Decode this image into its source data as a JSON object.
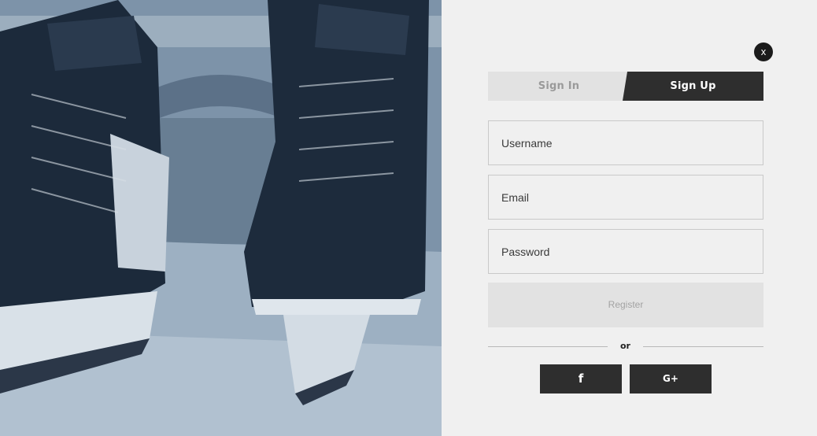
{
  "photo": {
    "alt": "hockey-skates-on-ice"
  },
  "close": {
    "label": "x"
  },
  "tabs": {
    "sign_in": "Sign In",
    "sign_up": "Sign Up",
    "active": "sign_up"
  },
  "form": {
    "username": {
      "placeholder": "Username",
      "value": ""
    },
    "email": {
      "placeholder": "Email",
      "value": ""
    },
    "password": {
      "placeholder": "Password",
      "value": ""
    },
    "register_label": "Register"
  },
  "divider": {
    "text": "or"
  },
  "social": {
    "facebook": {
      "label": "f",
      "icon": "facebook-icon"
    },
    "google": {
      "label": "G+",
      "icon": "google-plus-icon"
    }
  },
  "colors": {
    "dark": "#2e2e2e",
    "panel_bg": "#f0f0f0",
    "muted": "#e2e2e2"
  }
}
